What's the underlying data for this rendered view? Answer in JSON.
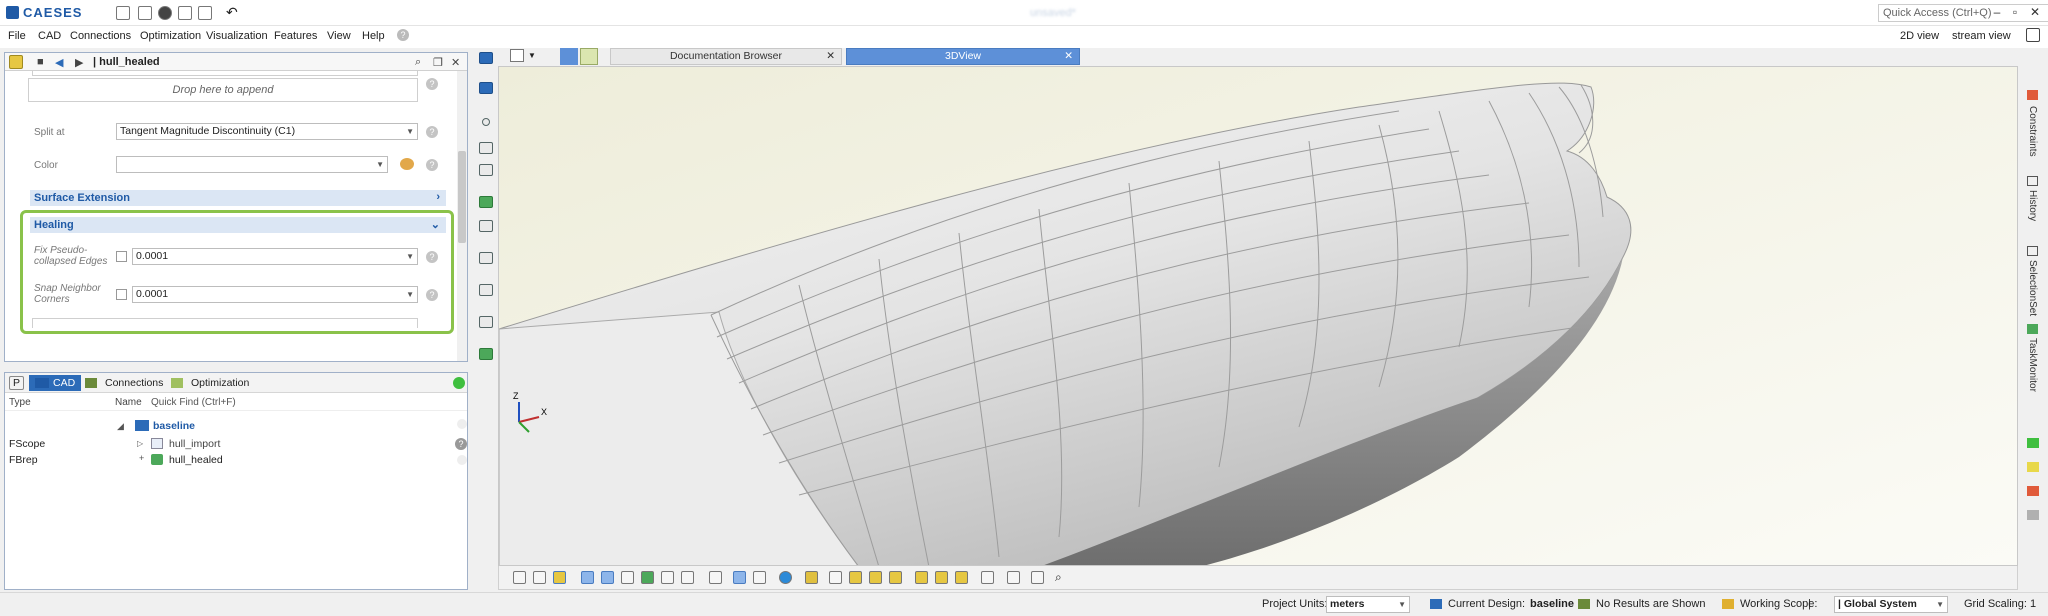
{
  "app": {
    "logo_text": "CAESES",
    "doc_title": "unsaved*",
    "quick_access_placeholder": "Quick Access (Ctrl+Q)"
  },
  "menu": {
    "items": [
      "File",
      "CAD",
      "Connections",
      "Optimization",
      "Visualization",
      "Features",
      "View",
      "Help"
    ],
    "right": [
      "2D view",
      "stream view"
    ]
  },
  "property_panel": {
    "title": "| hull_healed",
    "dropzone": "Drop here to append",
    "split_at": {
      "label": "Split at",
      "value": "Tangent Magnitude Discontinuity (C1)"
    },
    "color": {
      "label": "Color",
      "value": ""
    },
    "sections": {
      "surface_extension": "Surface Extension",
      "healing": "Healing"
    },
    "healing": {
      "fix_label": "Fix Pseudo-collapsed Edges",
      "fix_value": "0.0001",
      "snap_label": "Snap Neighbor Corners",
      "snap_value": "0.0001"
    }
  },
  "tree": {
    "tabs": [
      "P",
      "CAD",
      "Connections",
      "Optimization"
    ],
    "headers": {
      "type": "Type",
      "name": "Name",
      "find": "Quick Find (Ctrl+F)"
    },
    "folder": "baseline",
    "rows": [
      {
        "type": "FScope",
        "name": "hull_import"
      },
      {
        "type": "FBrep",
        "name": "hull_healed"
      }
    ]
  },
  "view_tabs": [
    "Documentation Browser",
    "3DView"
  ],
  "right_panel": [
    "Constraints",
    "History",
    "SelectionSet",
    "TaskMonitor"
  ],
  "status_colors": [
    "#3fbf3f",
    "#e8d84a",
    "#e05a3a",
    "#b0b0b0"
  ],
  "accent": "#1f5aa6",
  "highlight": "#8ac24a",
  "axis_labels": {
    "z": "Z",
    "x": "X"
  },
  "status": {
    "units_label": "Project Units:",
    "units_value": "meters",
    "design_label": "Current Design:",
    "design_value": "baseline",
    "results": "No Results are Shown",
    "scope_label": "Working Scope:",
    "scope_value": "|",
    "system": "| Global System",
    "grid": "Grid Scaling: 1"
  }
}
